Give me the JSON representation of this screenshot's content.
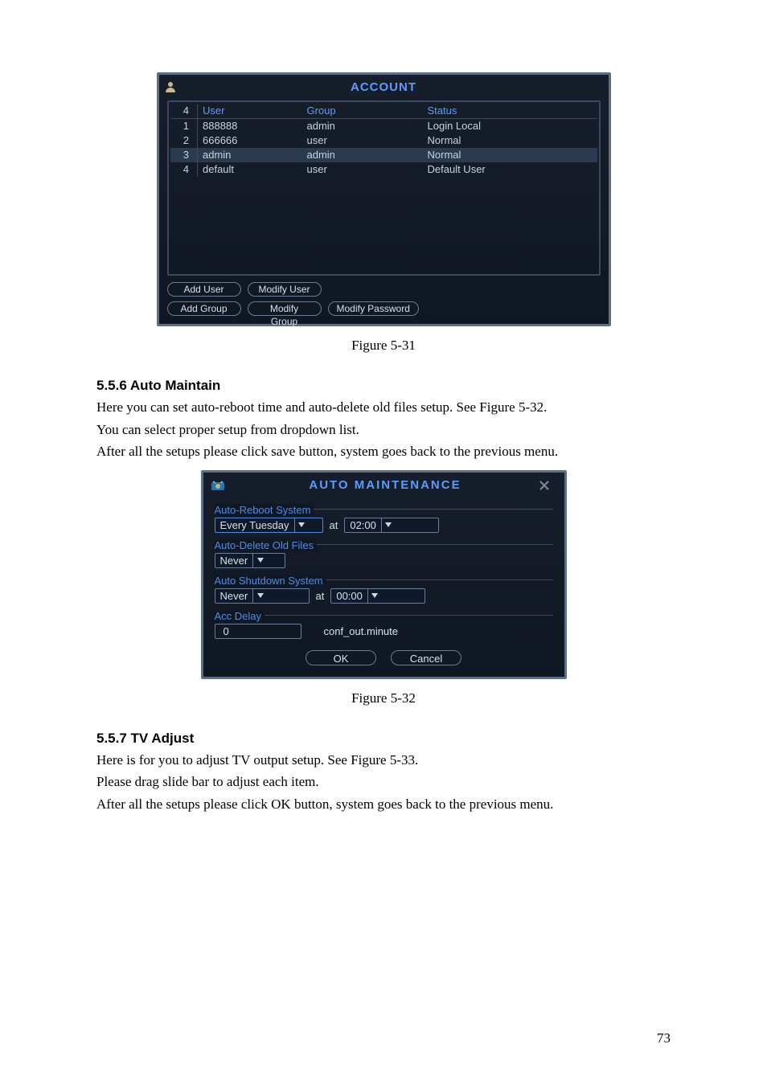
{
  "page_number": "73",
  "fig1_caption": "Figure 5-31",
  "fig2_caption": "Figure 5-32",
  "sec556_title": "5.5.6  Auto Maintain",
  "sec556_p1": "Here you can set auto-reboot time and auto-delete old files setup. See Figure 5-32.",
  "sec556_p2": "You can select proper setup from dropdown list.",
  "sec556_p3": "After all the setups please click save button, system goes back to the previous menu.",
  "sec557_title": "5.5.7  TV Adjust",
  "sec557_p1": "Here is for you to adjust TV output setup. See Figure 5-33.",
  "sec557_p2": "Please drag slide bar to adjust each item.",
  "sec557_p3": "After all the setups please click OK button, system goes back to the previous menu.",
  "account": {
    "title": "ACCOUNT",
    "header_count": "4",
    "cols": {
      "user": "User",
      "group": "Group",
      "status": "Status"
    },
    "rows": [
      {
        "n": "1",
        "user": "888888",
        "group": "admin",
        "status": "Login Local"
      },
      {
        "n": "2",
        "user": "666666",
        "group": "user",
        "status": "Normal"
      },
      {
        "n": "3",
        "user": "admin",
        "group": "admin",
        "status": "Normal"
      },
      {
        "n": "4",
        "user": "default",
        "group": "user",
        "status": "Default User"
      }
    ],
    "btns": {
      "add_user": "Add User",
      "modify_user": "Modify User",
      "add_group": "Add Group",
      "modify_group": "Modify Group",
      "modify_password": "Modify Password"
    }
  },
  "auto": {
    "title": "AUTO MAINTENANCE",
    "sec_reboot": "Auto-Reboot System",
    "day": "Every Tuesday",
    "at": "at",
    "time1": "02:00",
    "sec_delete": "Auto-Delete Old Files",
    "never": "Never",
    "sec_shutdown": "Auto Shutdown System",
    "never2": "Never",
    "time2": "00:00",
    "sec_accdelay": "Acc Delay",
    "accdelay_val": "0",
    "accdelay_unit": "conf_out.minute",
    "ok": "OK",
    "cancel": "Cancel"
  }
}
